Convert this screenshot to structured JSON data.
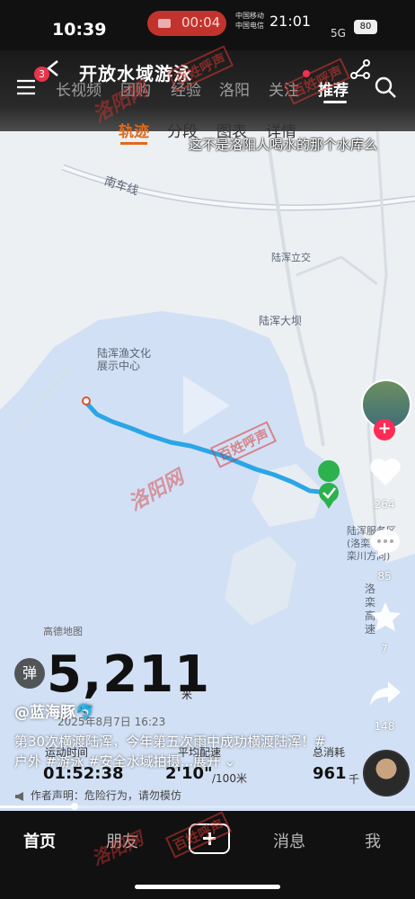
{
  "status_bar": {
    "time": "10:39",
    "recording_time": "00:04",
    "carrier_1": "中国移动",
    "carrier_2": "中国电信",
    "time_secondary": "21:01",
    "network": "5G",
    "battery": "80"
  },
  "app": {
    "activity_title": "开放水域游泳",
    "notification_badge": "3",
    "feed_tabs": [
      "长视频",
      "团购",
      "经验",
      "洛阳",
      "关注",
      "推荐"
    ],
    "active_feed_tab": "推荐",
    "sub_tabs": [
      "轨迹",
      "分段",
      "图表",
      "详情"
    ],
    "active_sub_tab": "轨迹",
    "danmaku": "这不是洛阳人喝水的那个水库么",
    "map_labels": {
      "road": "南车线",
      "interchange": "陆浑立交",
      "dam": "陆浑大坝",
      "center": "陆浑渔文化\n展示中心",
      "service": "陆浑服务区\n(洛栾\n栾川方向)",
      "side": "洛\n栾\n高\n速",
      "map_provider": "高德地图"
    },
    "workout": {
      "distance": "5,211",
      "distance_unit": "米",
      "date": "2025年8月7日 16:23",
      "time_label": "运动时间",
      "time_value": "01:52:38",
      "pace_label": "平均配速",
      "pace_value": "2'10\"",
      "pace_unit": "/100米",
      "cal_label": "总消耗",
      "cal_value": "961",
      "cal_unit": "千"
    },
    "danmaku_button": "弹",
    "author": "@蓝海豚🐬",
    "caption": "第30次横渡陆浑，今年第五次雨中成功横渡陆浑！#户外 #游泳 #安全水域拍摄...展开",
    "disclaimer": "作者声明：危险行为，请勿模仿",
    "actions": {
      "likes": "264",
      "comments": "85",
      "favorites": "7",
      "shares": "148"
    },
    "watermarks": [
      "洛阳网",
      "百姓呼声"
    ],
    "video_progress": 0.18,
    "bottom_nav": [
      "首页",
      "朋友",
      "消息",
      "我"
    ],
    "active_bottom_nav": "首页"
  }
}
